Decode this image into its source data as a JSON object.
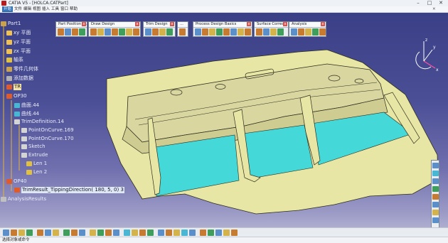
{
  "window": {
    "title": "CATIA V5 - [HOLCA.CATPart]",
    "buttons": [
      "–",
      "□",
      "✕"
    ]
  },
  "menubar": [
    "开始",
    "文件",
    "编辑",
    "视图",
    "插入",
    "工具",
    "窗口",
    "帮助"
  ],
  "tree": {
    "root": "Part1",
    "items": [
      {
        "label": "xy 平面",
        "icon": "plane-icon",
        "color": "#f0c050"
      },
      {
        "label": "yz 平面",
        "icon": "plane-icon",
        "color": "#f0c050"
      },
      {
        "label": "zx 平面",
        "icon": "plane-icon",
        "color": "#f0c050"
      },
      {
        "label": "轴系",
        "icon": "axis-icon",
        "color": "#e0c040"
      },
      {
        "label": "零件几何体",
        "icon": "body-icon",
        "color": "#c9a24a"
      },
      {
        "label": "添加数据",
        "icon": "data-icon",
        "color": "#b0b0b0"
      },
      {
        "label": "TR",
        "icon": "tr-icon",
        "color": "#e05a2a"
      },
      {
        "label": "OP30",
        "icon": "op-icon",
        "color": "#e05a2a"
      },
      {
        "label": "曲面.44",
        "icon": "surface-icon",
        "color": "#47b7d4"
      },
      {
        "label": "曲线.44",
        "icon": "curve-icon",
        "color": "#47b7d4"
      },
      {
        "label": "TrimDefinition.14",
        "icon": "trim-icon",
        "color": "#d4d4d4"
      },
      {
        "label": "PointOnCurve.169",
        "icon": "point-icon",
        "color": "#d4d4d4"
      },
      {
        "label": "PointOnCurve.170",
        "icon": "point-icon",
        "color": "#d4d4d4"
      },
      {
        "label": "Sketch",
        "icon": "sketch-icon",
        "color": "#d4d4d4"
      },
      {
        "label": "Extrude",
        "icon": "extrude-icon",
        "color": "#d4d4d4"
      },
      {
        "label": "Len 1",
        "icon": "length-icon",
        "color": "#e0c040"
      },
      {
        "label": "Len 2",
        "icon": "length-icon",
        "color": "#e0c040"
      },
      {
        "label": "OP40",
        "icon": "op-icon",
        "color": "#e05a2a"
      },
      {
        "label": "TrimResult_TippingDirection( 180,   5,   0) 3",
        "icon": "result-icon",
        "color": "#e05a2a"
      },
      {
        "label": "AnalysisResults",
        "icon": "analysis-icon",
        "color": "#c0c0c0"
      }
    ]
  },
  "toolbars": [
    {
      "title": "Part Position / ...",
      "count": 5
    },
    {
      "title": "Draw Design",
      "count": 9
    },
    {
      "title": "Trim Design",
      "count": 5
    },
    {
      "title": "...",
      "count": 1
    },
    {
      "title": "Process Design Basics",
      "count": 9
    },
    {
      "title": "Surface Correc...",
      "count": 5
    },
    {
      "title": "Analysis",
      "count": 6
    }
  ],
  "compass": {
    "axes": [
      "z",
      "x",
      "y"
    ]
  },
  "status": {
    "text": "选择对象或命令"
  },
  "colors": {
    "bg_top": "#3a3f86",
    "bg_bottom": "#b7b6d4",
    "surface": "#e8e6a4",
    "surface_edge": "#2d2d1e",
    "cyan": "#45d8d8",
    "accent": "#e05a2a"
  }
}
